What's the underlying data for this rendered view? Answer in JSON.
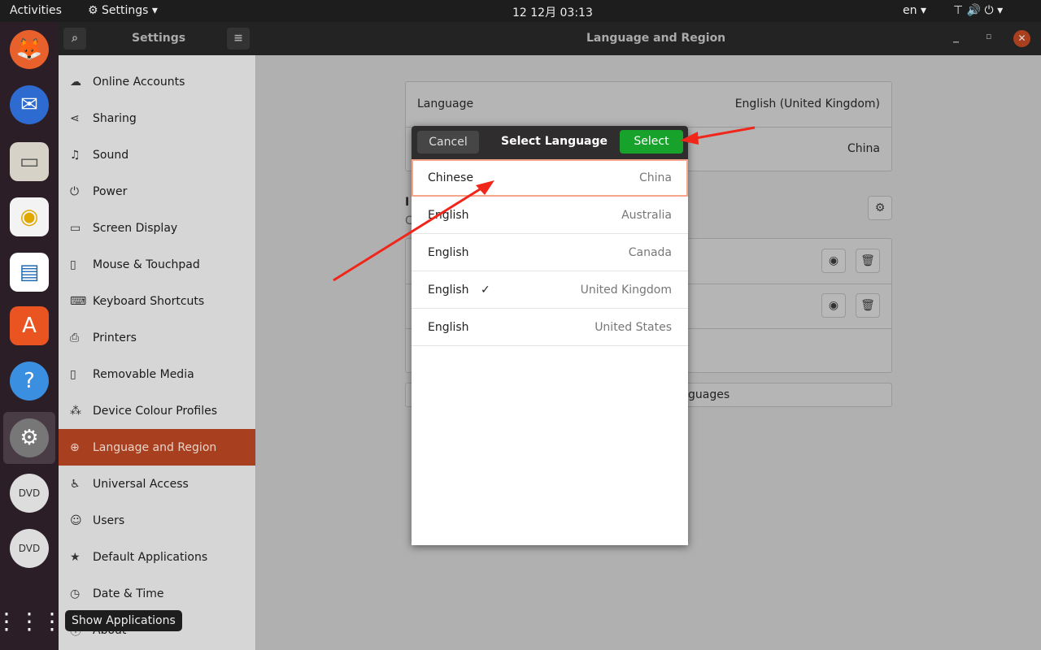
{
  "topbar": {
    "activities": "Activities",
    "app_menu": "Settings",
    "clock": "12 12月  03:13",
    "input_source": "en"
  },
  "window": {
    "sidebar_title": "Settings",
    "title": "Language and Region"
  },
  "sidebar": {
    "items": [
      {
        "label": "Online Accounts",
        "icon": "cloud-icon"
      },
      {
        "label": "Sharing",
        "icon": "share-icon"
      },
      {
        "label": "Sound",
        "icon": "music-note-icon"
      },
      {
        "label": "Power",
        "icon": "power-icon"
      },
      {
        "label": "Screen Display",
        "icon": "display-icon"
      },
      {
        "label": "Mouse & Touchpad",
        "icon": "mouse-icon"
      },
      {
        "label": "Keyboard Shortcuts",
        "icon": "keyboard-icon"
      },
      {
        "label": "Printers",
        "icon": "printer-icon"
      },
      {
        "label": "Removable Media",
        "icon": "usb-icon"
      },
      {
        "label": "Device Colour Profiles",
        "icon": "color-icon"
      },
      {
        "label": "Language and Region",
        "icon": "globe-icon",
        "active": true
      },
      {
        "label": "Universal Access",
        "icon": "accessibility-icon"
      },
      {
        "label": "Users",
        "icon": "user-icon"
      },
      {
        "label": "Default Applications",
        "icon": "star-icon"
      },
      {
        "label": "Date & Time",
        "icon": "clock-icon"
      },
      {
        "label": "About",
        "icon": "info-icon"
      }
    ]
  },
  "main": {
    "language_label": "Language",
    "language_value": "English (United Kingdom)",
    "formats_value": "China",
    "manage_button_partial": "guages",
    "section_partial": "I",
    "sub_partial": "C"
  },
  "dialog": {
    "title": "Select Language",
    "cancel": "Cancel",
    "select": "Select",
    "select_color": "#17a32b",
    "rows": [
      {
        "language": "Chinese",
        "country": "China",
        "highlighted": true
      },
      {
        "language": "English",
        "country": "Australia"
      },
      {
        "language": "English",
        "country": "Canada"
      },
      {
        "language": "English",
        "country": "United Kingdom",
        "checked": true
      },
      {
        "language": "English",
        "country": "United States"
      }
    ]
  },
  "tooltip": "Show Applications",
  "annotation_color": "#f0261b"
}
